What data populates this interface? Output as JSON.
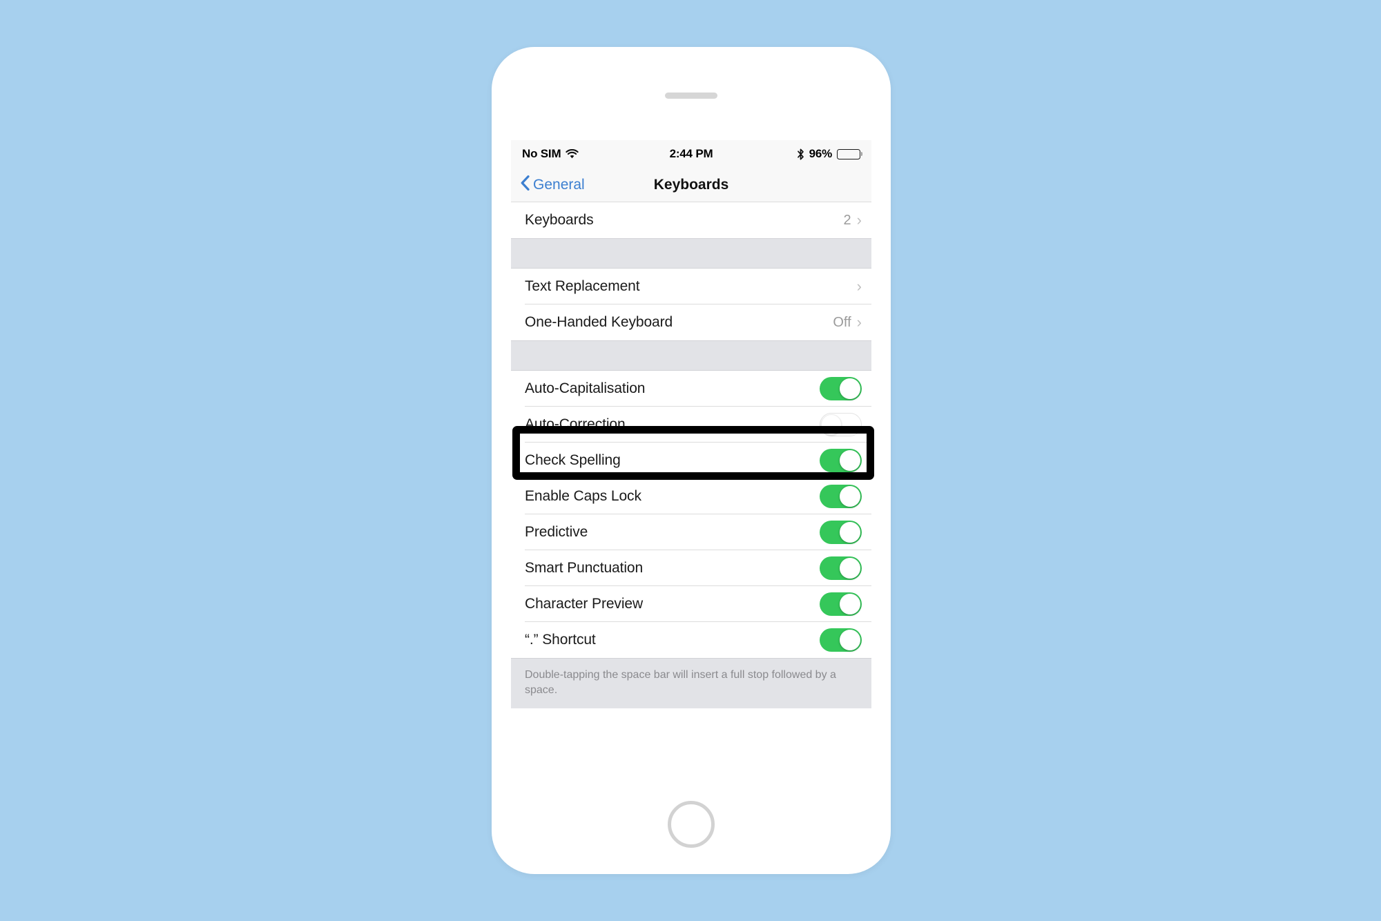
{
  "background_color": "#a7d0ee",
  "accent_color": "#3c7fd0",
  "toggle_on_color": "#35c75a",
  "status_bar": {
    "carrier": "No SIM",
    "wifi_icon": "wifi-icon",
    "time": "2:44 PM",
    "bluetooth_icon": "bluetooth-icon",
    "battery_percent": "96%",
    "battery_icon": "battery-full-icon"
  },
  "nav_bar": {
    "back_label": "General",
    "back_icon": "chevron-left-icon",
    "title": "Keyboards"
  },
  "sections": [
    {
      "rows": [
        {
          "label": "Keyboards",
          "value": "2",
          "type": "disclosure",
          "icon": "chevron-right-icon"
        }
      ]
    },
    {
      "rows": [
        {
          "label": "Text Replacement",
          "value": "",
          "type": "disclosure",
          "icon": "chevron-right-icon"
        },
        {
          "label": "One-Handed Keyboard",
          "value": "Off",
          "type": "disclosure",
          "icon": "chevron-right-icon"
        }
      ]
    },
    {
      "rows": [
        {
          "label": "Auto-Capitalisation",
          "state": "on",
          "type": "toggle"
        },
        {
          "label": "Auto-Correction",
          "state": "off",
          "type": "toggle",
          "highlighted": true
        },
        {
          "label": "Check Spelling",
          "state": "on",
          "type": "toggle"
        },
        {
          "label": "Enable Caps Lock",
          "state": "on",
          "type": "toggle"
        },
        {
          "label": "Predictive",
          "state": "on",
          "type": "toggle"
        },
        {
          "label": "Smart Punctuation",
          "state": "on",
          "type": "toggle"
        },
        {
          "label": "Character Preview",
          "state": "on",
          "type": "toggle"
        },
        {
          "label": "“.” Shortcut",
          "state": "on",
          "type": "toggle"
        }
      ],
      "footer": "Double-tapping the space bar will insert a full stop followed by a space."
    }
  ],
  "device": {
    "speaker": "earpiece-speaker",
    "home_button": "home-button"
  }
}
